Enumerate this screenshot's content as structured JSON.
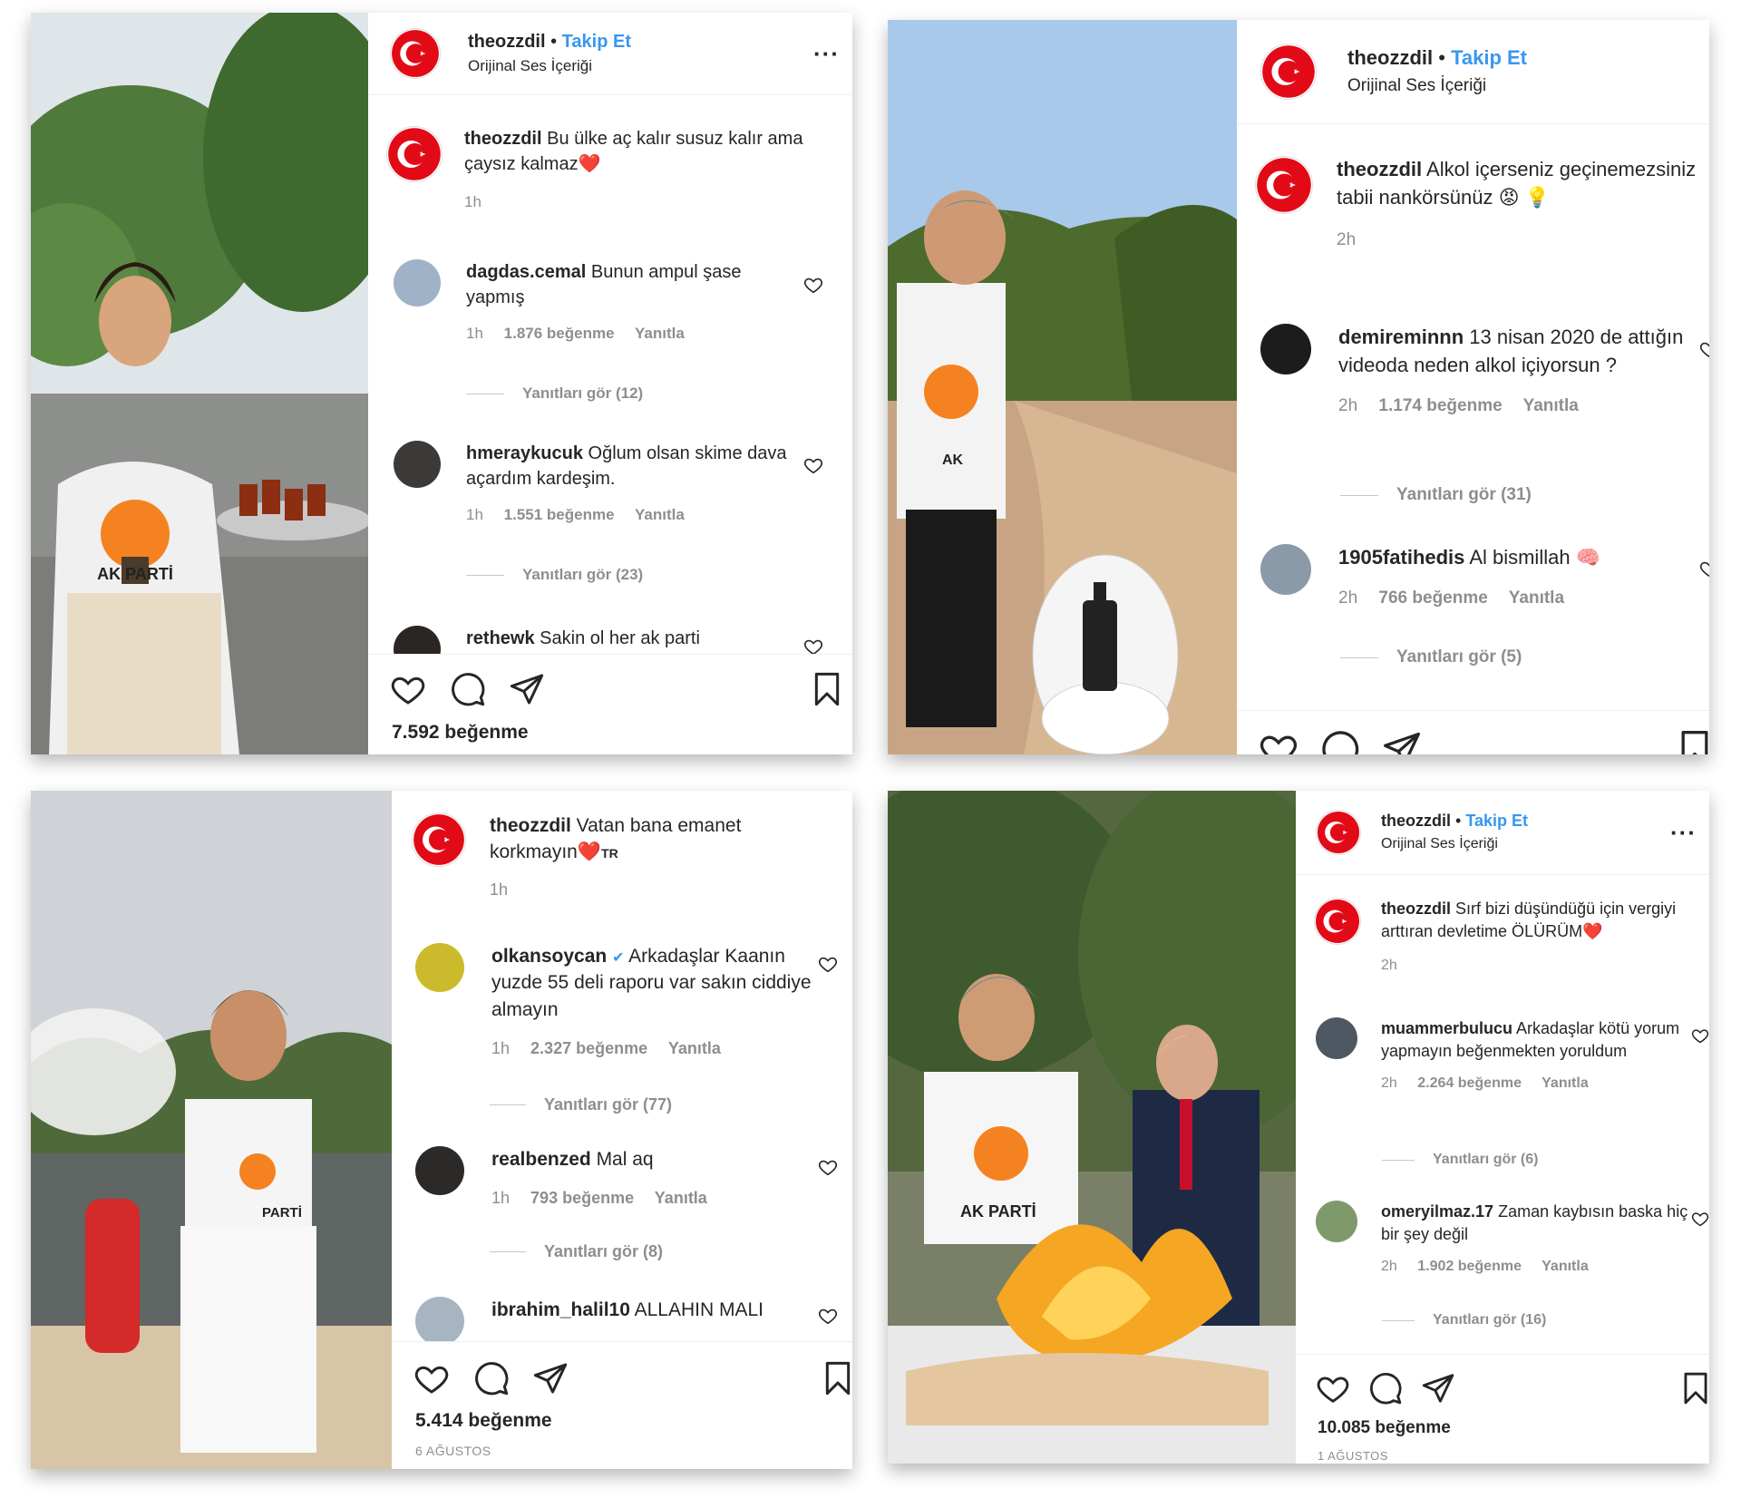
{
  "colors": {
    "accent_blue": "#3897f0",
    "ak_orange": "#f58220",
    "heart_red": "#e0192f"
  },
  "posts": [
    {
      "username": "theozzdil",
      "follow": "Takip Et",
      "audio": "Orijinal Ses İçeriği",
      "caption": "Bu ülke aç kalır susuz kalır ama çaysız kalmaz",
      "caption_emoji": "❤️",
      "caption_time": "1h",
      "comments": [
        {
          "user": "dagdas.cemal",
          "text": "Bunun ampul şase yapmış",
          "time": "1h",
          "likes": "1.876 beğenme",
          "reply": "Yanıtla",
          "view_replies": "Yanıtları gör (12)"
        },
        {
          "user": "hmeraykucuk",
          "text": "Oğlum olsan skime dava açardım kardeşim.",
          "time": "1h",
          "likes": "1.551 beğenme",
          "reply": "Yanıtla",
          "view_replies": "Yanıtları gör (23)"
        },
        {
          "user": "rethewk",
          "text": "Sakin ol her ak parti"
        }
      ],
      "like_count": "7.592 beğenme",
      "shirt_text": "AK PARTİ"
    },
    {
      "username": "theozzdil",
      "follow": "Takip Et",
      "audio": "Orijinal Ses İçeriği",
      "caption": "Alkol içerseniz geçinemezsiniz tabii nankörsünüz",
      "caption_emoji": "😡 💡",
      "caption_time": "2h",
      "comments": [
        {
          "user": "demireminnn",
          "text": "13 nisan 2020 de attığın videoda neden alkol içiyorsun ?",
          "time": "2h",
          "likes": "1.174 beğenme",
          "reply": "Yanıtla",
          "view_replies": "Yanıtları gör (31)"
        },
        {
          "user": "1905fatihedis",
          "text": "Al bismillah",
          "emoji": "🧠",
          "time": "2h",
          "likes": "766 beğenme",
          "reply": "Yanıtla",
          "view_replies": "Yanıtları gör (5)"
        }
      ],
      "shirt_text": "AK"
    },
    {
      "username": "theozzdil",
      "caption": "Vatan bana emanet korkmayın",
      "caption_emoji": "❤️",
      "caption_flag": "TR",
      "caption_time": "1h",
      "comments": [
        {
          "user": "olkansoycan",
          "verified": "✔",
          "text": "Arkadaşlar Kaanın yuzde 55 deli raporu var sakın ciddiye almayın",
          "time": "1h",
          "likes": "2.327 beğenme",
          "reply": "Yanıtla",
          "view_replies": "Yanıtları gör (77)"
        },
        {
          "user": "realbenzed",
          "text": "Mal aq",
          "time": "1h",
          "likes": "793 beğenme",
          "reply": "Yanıtla",
          "view_replies": "Yanıtları gör (8)"
        },
        {
          "user": "ibrahim_halil10",
          "text": "ALLAHIN MALI"
        }
      ],
      "like_count": "5.414 beğenme",
      "date": "6 AĞUSTOS",
      "shirt_text": "PARTİ"
    },
    {
      "username": "theozzdil",
      "follow": "Takip Et",
      "audio": "Orijinal Ses İçeriği",
      "caption": "Sırf bizi düşündüğü için vergiyi arttıran devletime ÖLÜRÜM",
      "caption_emoji": "❤️",
      "caption_time": "2h",
      "comments": [
        {
          "user": "muammerbulucu",
          "text": "Arkadaşlar kötü yorum yapmayın beğenmekten yoruldum",
          "time": "2h",
          "likes": "2.264 beğenme",
          "reply": "Yanıtla",
          "view_replies": "Yanıtları gör (6)"
        },
        {
          "user": "omeryilmaz.17",
          "text": "Zaman kaybısın baska hiç bir şey değil",
          "time": "2h",
          "likes": "1.902 beğenme",
          "reply": "Yanıtla",
          "view_replies": "Yanıtları gör (16)"
        }
      ],
      "like_count": "10.085 beğenme",
      "date": "1 AĞUSTOS",
      "shirt_text": "AK PARTİ"
    }
  ]
}
